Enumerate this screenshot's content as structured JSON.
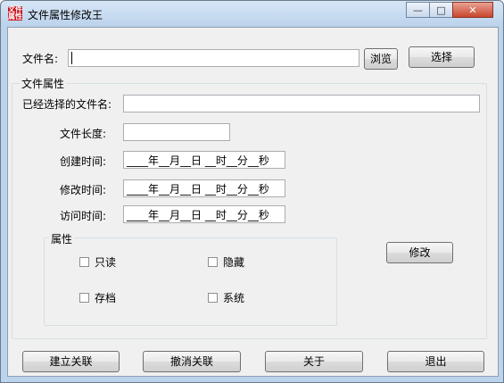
{
  "window": {
    "title": "文件属性修改王",
    "icon_text": "文件属性",
    "minimize_glyph": "—",
    "maximize_glyph": "□",
    "close_glyph": "✕"
  },
  "file": {
    "label": "文件名:",
    "value": "",
    "browse_label": "浏览",
    "select_label": "选择"
  },
  "attributes_group": {
    "title": "文件属性",
    "selected_label": "已经选择的文件名:",
    "selected_value": "",
    "length_label": "文件长度:",
    "length_value": "",
    "created_label": "创建时间:",
    "created_value": "____年__月__日 __时__分__秒",
    "modified_label": "修改时间:",
    "modified_value": "____年__月__日 __时__分__秒",
    "accessed_label": "访问时间:",
    "accessed_value": "____年__月__日 __时__分__秒",
    "modify_label": "修改"
  },
  "props_group": {
    "title": "属性",
    "readonly_label": "只读",
    "hidden_label": "隐藏",
    "archive_label": "存档",
    "system_label": "系统",
    "readonly_checked": false,
    "hidden_checked": false,
    "archive_checked": false,
    "system_checked": false
  },
  "footer": {
    "associate_label": "建立关联",
    "unassociate_label": "撤消关联",
    "about_label": "关于",
    "exit_label": "退出"
  }
}
